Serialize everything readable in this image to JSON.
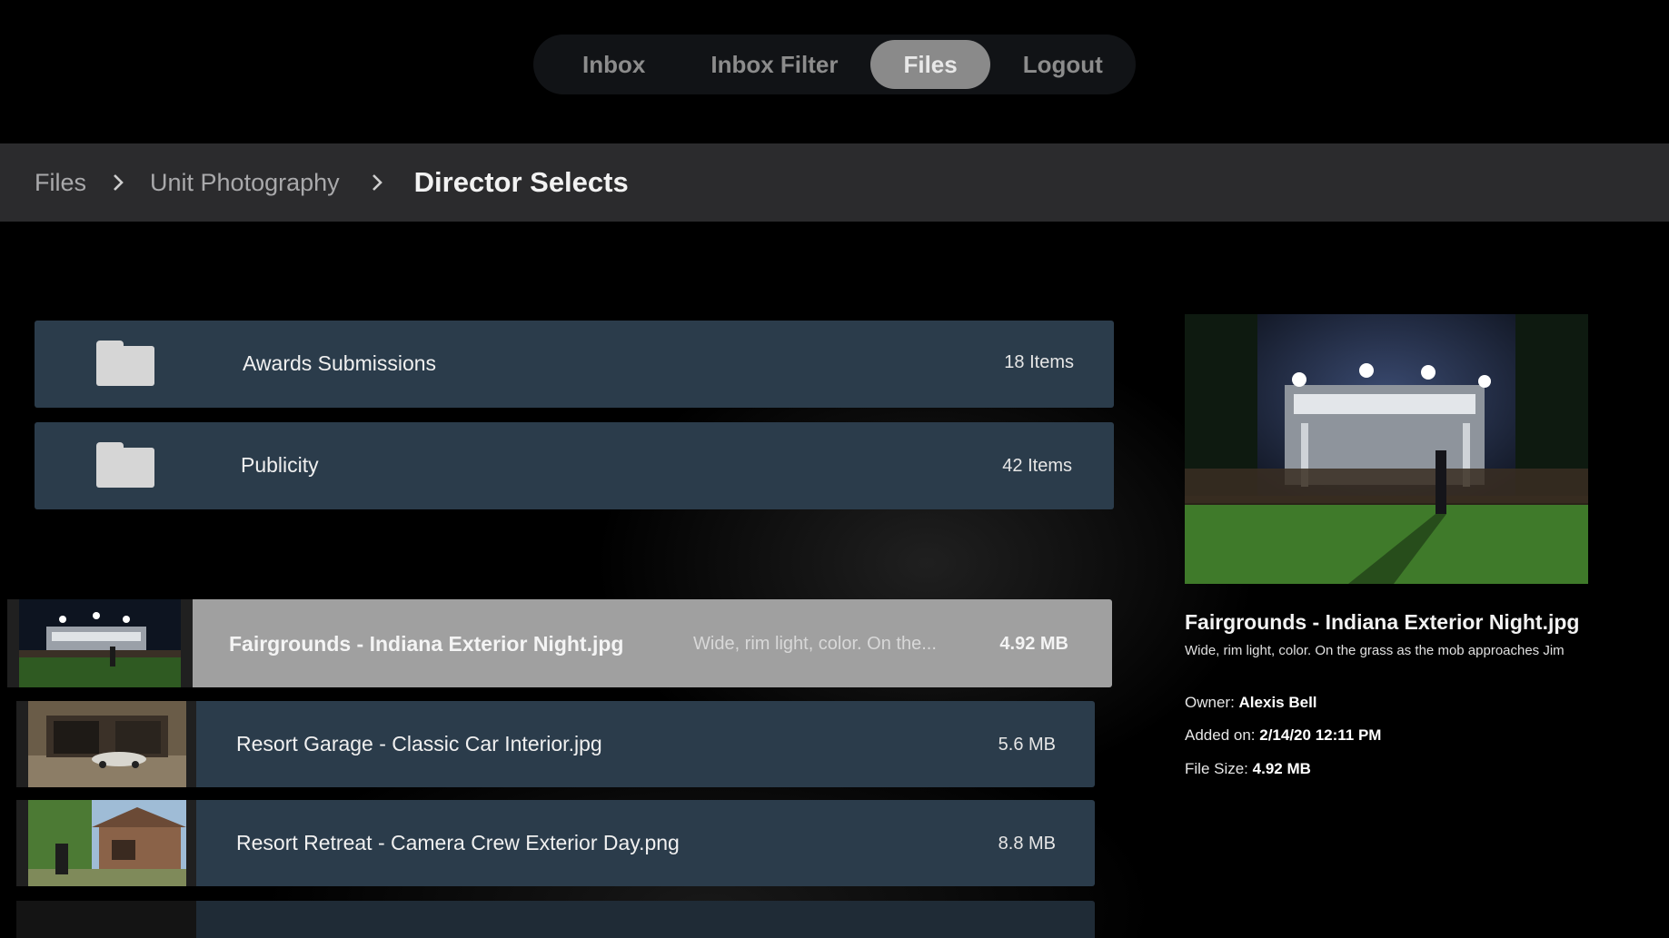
{
  "nav": {
    "tabs": [
      {
        "label": "Inbox"
      },
      {
        "label": "Inbox Filter"
      },
      {
        "label": "Files",
        "active": true
      },
      {
        "label": "Logout"
      }
    ]
  },
  "breadcrumb": {
    "items": [
      "Files",
      "Unit Photography",
      "Director Selects"
    ]
  },
  "folders": [
    {
      "name": "Awards Submissions",
      "count": "18 Items",
      "icon": "folder-icon"
    },
    {
      "name": "Publicity",
      "count": "42 Items",
      "icon": "folder-icon"
    }
  ],
  "files": [
    {
      "name": "Fairgrounds - Indiana Exterior Night.jpg",
      "desc": "Wide, rim light, color. On the...",
      "size": "4.92 MB",
      "selected": true
    },
    {
      "name": "Resort Garage - Classic Car Interior.jpg",
      "size": "5.6 MB"
    },
    {
      "name": "Resort Retreat - Camera Crew Exterior Day.png",
      "size": "8.8 MB"
    }
  ],
  "detail": {
    "title": "Fairgrounds - Indiana Exterior Night.jpg",
    "description": "Wide, rim light, color. On the grass as the mob approaches Jim",
    "owner_label": "Owner:",
    "owner": "Alexis Bell",
    "added_label": "Added on:",
    "added": "2/14/20 12:11 PM",
    "size_label": "File Size:",
    "size": "4.92 MB"
  },
  "colors": {
    "row_bg": "#2b3c4b",
    "selected_row_bg": "#a0a0a0",
    "breadcrumb_bg": "#2b2b2d",
    "active_tab_bg": "#8a8a8a"
  }
}
